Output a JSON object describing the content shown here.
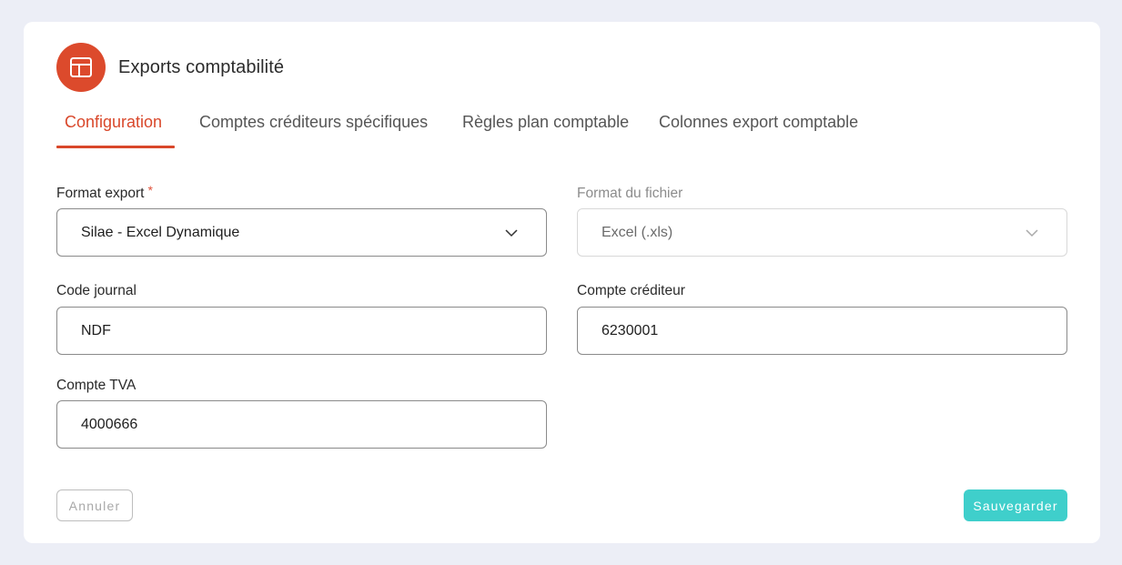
{
  "header": {
    "title": "Exports comptabilité",
    "icon": "layout-icon",
    "icon_color": "#dc4a2c"
  },
  "tabs": [
    {
      "label": "Configuration",
      "active": true
    },
    {
      "label": "Comptes créditeurs spécifiques",
      "active": false
    },
    {
      "label": "Règles plan comptable",
      "active": false
    },
    {
      "label": "Colonnes export comptable",
      "active": false
    }
  ],
  "form": {
    "format_export": {
      "label": "Format export",
      "required": "*",
      "value": "Silae - Excel Dynamique"
    },
    "format_fichier": {
      "label": "Format du fichier",
      "value": "Excel (.xls)",
      "disabled": true
    },
    "code_journal": {
      "label": "Code journal",
      "value": "NDF"
    },
    "compte_crediteur": {
      "label": "Compte créditeur",
      "value": "6230001"
    },
    "compte_tva": {
      "label": "Compte TVA",
      "value": "4000666"
    }
  },
  "actions": {
    "cancel_label": "Annuler",
    "save_label": "Sauvegarder",
    "save_color": "#3fcfcb"
  },
  "colors": {
    "accent": "#d9472a",
    "background": "#eceef6"
  }
}
